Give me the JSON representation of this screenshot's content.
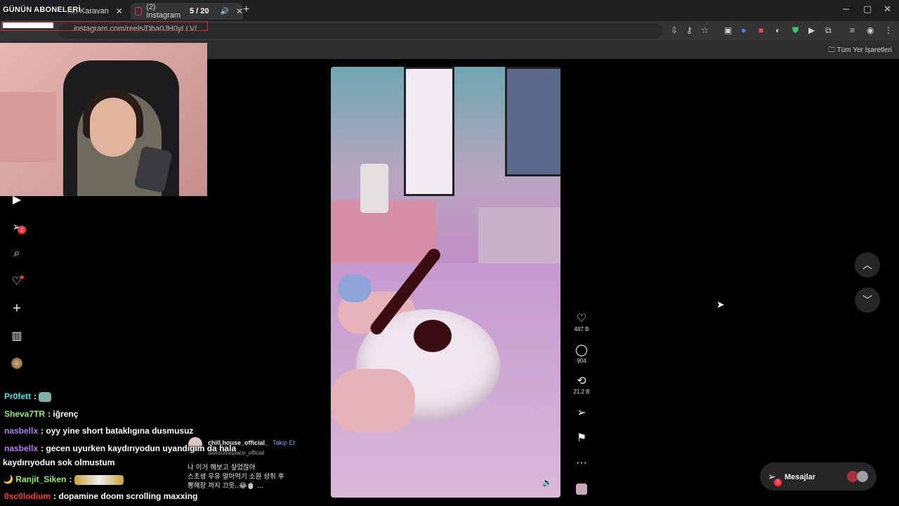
{
  "tabs": [
    {
      "label": "nin Karavan"
    },
    {
      "label": "(2) Instagram"
    }
  ],
  "window_controls": {
    "minimize": "─",
    "maximize": "▢",
    "close": "✕"
  },
  "new_tab": "+",
  "address": {
    "url": "instagram.com/reels/Dba0JH0yLLV/"
  },
  "bookmarks": {
    "all_label": "Tüm Yer İşaretleri"
  },
  "overlay": {
    "title": "GÜNÜN ABONELERİ",
    "counter": "5 / 20"
  },
  "sidebar": {
    "items": [
      {
        "icon": "reels-icon"
      },
      {
        "icon": "messages-icon",
        "badge": "2"
      },
      {
        "icon": "search-icon"
      },
      {
        "icon": "notifications-icon"
      },
      {
        "icon": "create-icon"
      },
      {
        "icon": "dashboard-icon"
      },
      {
        "icon": "profile-icon"
      }
    ]
  },
  "reel": {
    "likes": "487 B",
    "comments": "904",
    "reposts": "21,2 B",
    "author": "chill.house_official_",
    "follow": "Takip Et",
    "author_sub": "awesomeplace_official",
    "caption": "나 이거 해보고 싶었잖아\n스초생 우유 말아먹기 소원 성취 후\n뽕해장 까지 끄읏..😂🍵 ..."
  },
  "messages": {
    "label": "Mesajlar",
    "badge": "2"
  },
  "chat": [
    {
      "user": "Pr0fett",
      "color": "#48e3e6",
      "text": ""
    },
    {
      "user": "Sheva7TR",
      "color": "#8ef06a",
      "text": "iğrenç"
    },
    {
      "user": "nasbellx",
      "color": "#b27cf5",
      "text": "oyy yine short bataklıgına dusmusuz"
    },
    {
      "user": "nasbellx",
      "color": "#b27cf5",
      "text": "gecen uyurken kaydırıyodun uyandıgım da hala"
    },
    {
      "user": "",
      "color": "#ffffff",
      "text": "kaydırıyodun sok olmustum"
    },
    {
      "user": "Ranjit_Siken",
      "color": "#8ef06a",
      "text": ""
    },
    {
      "user": "0sc0lodium",
      "color": "#ff3b3b",
      "text": "dopamine doom scrolling maxxing"
    }
  ],
  "colors": {
    "badge": "#ff3040",
    "follow": "#6da8ff",
    "page_bg": "#000000"
  }
}
